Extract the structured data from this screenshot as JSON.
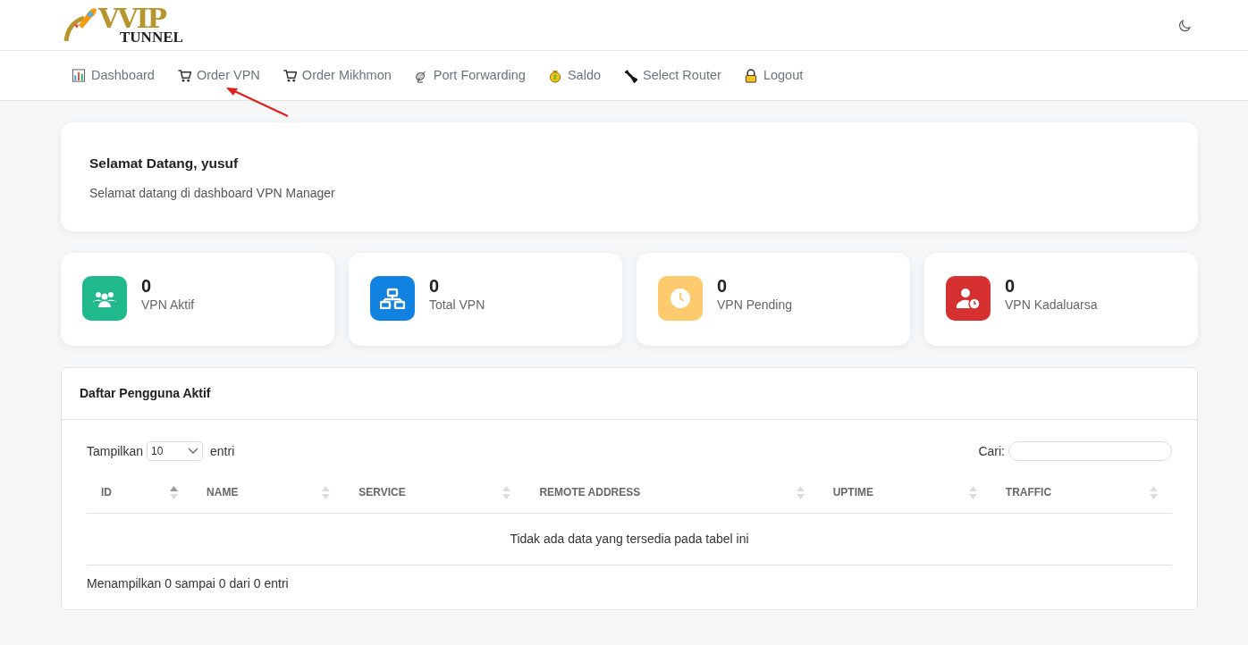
{
  "logo": {
    "word": "VVIP",
    "subword": "TUNNEL"
  },
  "nav": [
    {
      "label": "Dashboard"
    },
    {
      "label": "Order VPN"
    },
    {
      "label": "Order Mikhmon"
    },
    {
      "label": "Port Forwarding"
    },
    {
      "label": "Saldo"
    },
    {
      "label": "Select Router"
    },
    {
      "label": "Logout"
    }
  ],
  "welcome": {
    "title": "Selamat Datang, yusuf",
    "text": "Selamat datang di dashboard VPN Manager"
  },
  "stats": [
    {
      "value": "0",
      "label": "VPN Aktif",
      "color": "#20b98c"
    },
    {
      "value": "0",
      "label": "Total VPN",
      "color": "#1282e0"
    },
    {
      "value": "0",
      "label": "VPN Pending",
      "color": "#fdcb6e"
    },
    {
      "value": "0",
      "label": "VPN Kadaluarsa",
      "color": "#d63031"
    }
  ],
  "table": {
    "title": "Daftar Pengguna Aktif",
    "length_prefix": "Tampilkan",
    "length_value": "10",
    "length_suffix": "entri",
    "search_label": "Cari:",
    "columns": [
      {
        "label": "ID",
        "sorted": true
      },
      {
        "label": "NAME",
        "sorted": false
      },
      {
        "label": "SERVICE",
        "sorted": false
      },
      {
        "label": "REMOTE ADDRESS",
        "sorted": false
      },
      {
        "label": "UPTIME",
        "sorted": false
      },
      {
        "label": "TRAFFIC",
        "sorted": false
      }
    ],
    "empty_text": "Tidak ada data yang tersedia pada tabel ini",
    "info": "Menampilkan 0 sampai 0 dari 0 entri"
  }
}
